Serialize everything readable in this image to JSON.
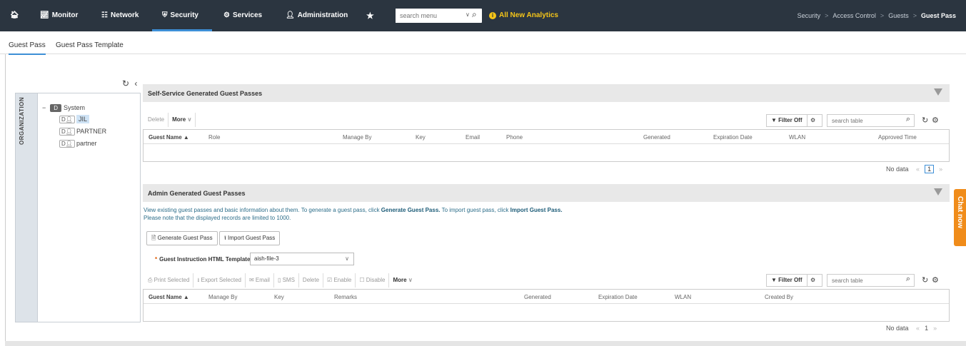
{
  "nav": {
    "items": [
      {
        "label": "Monitor",
        "icon": "chart-line-icon"
      },
      {
        "label": "Network",
        "icon": "network-icon"
      },
      {
        "label": "Security",
        "icon": "shield-icon"
      },
      {
        "label": "Services",
        "icon": "gears-icon"
      },
      {
        "label": "Administration",
        "icon": "user-icon"
      }
    ],
    "search_placeholder": "search menu",
    "analytics_label": "All New Analytics",
    "breadcrumb": [
      "Security",
      "Access Control",
      "Guests",
      "Guest Pass"
    ]
  },
  "tabs": [
    "Guest Pass",
    "Guest Pass Template"
  ],
  "org": {
    "label": "ORGANIZATION",
    "root_badge": "D",
    "root_label": "System",
    "children": [
      {
        "badge": "D",
        "label": "JIL"
      },
      {
        "badge": "D",
        "label": "PARTNER"
      },
      {
        "badge": "D",
        "label": "partner"
      }
    ]
  },
  "self_service": {
    "title": "Self-Service Generated Guest Passes",
    "toolbar": {
      "delete": "Delete",
      "more": "More"
    },
    "filter": "Filter Off",
    "search_placeholder": "search table",
    "columns": [
      "Guest Name",
      "Role",
      "Manage By",
      "Key",
      "Email",
      "Phone",
      "Generated",
      "Expiration Date",
      "WLAN",
      "Approved Time"
    ],
    "no_data": "No data",
    "page": "1"
  },
  "admin": {
    "title": "Admin Generated Guest Passes",
    "desc_1a": "View existing guest passes and basic information about them. To generate a guest pass, click ",
    "desc_1b": "Generate Guest Pass.",
    "desc_1c": " To import guest pass, click ",
    "desc_1d": "Import Guest Pass.",
    "desc_2": "Please note that the displayed records are limited to 1000.",
    "generate_btn": "Generate Guest Pass",
    "import_btn": "Import Guest Pass",
    "template_label": "Guest Instruction HTML Template:",
    "template_value": "aish-file-3",
    "toolbar": {
      "print": "Print Selected",
      "export": "Export Selected",
      "email": "Email",
      "sms": "SMS",
      "delete": "Delete",
      "enable": "Enable",
      "disable": "Disable",
      "more": "More"
    },
    "filter": "Filter Off",
    "search_placeholder": "search table",
    "columns": [
      "Guest Name",
      "Manage By",
      "Key",
      "Remarks",
      "Generated",
      "Expiration Date",
      "WLAN",
      "Created By"
    ],
    "no_data": "No data",
    "page": "1"
  },
  "chat_label": "Chat now"
}
